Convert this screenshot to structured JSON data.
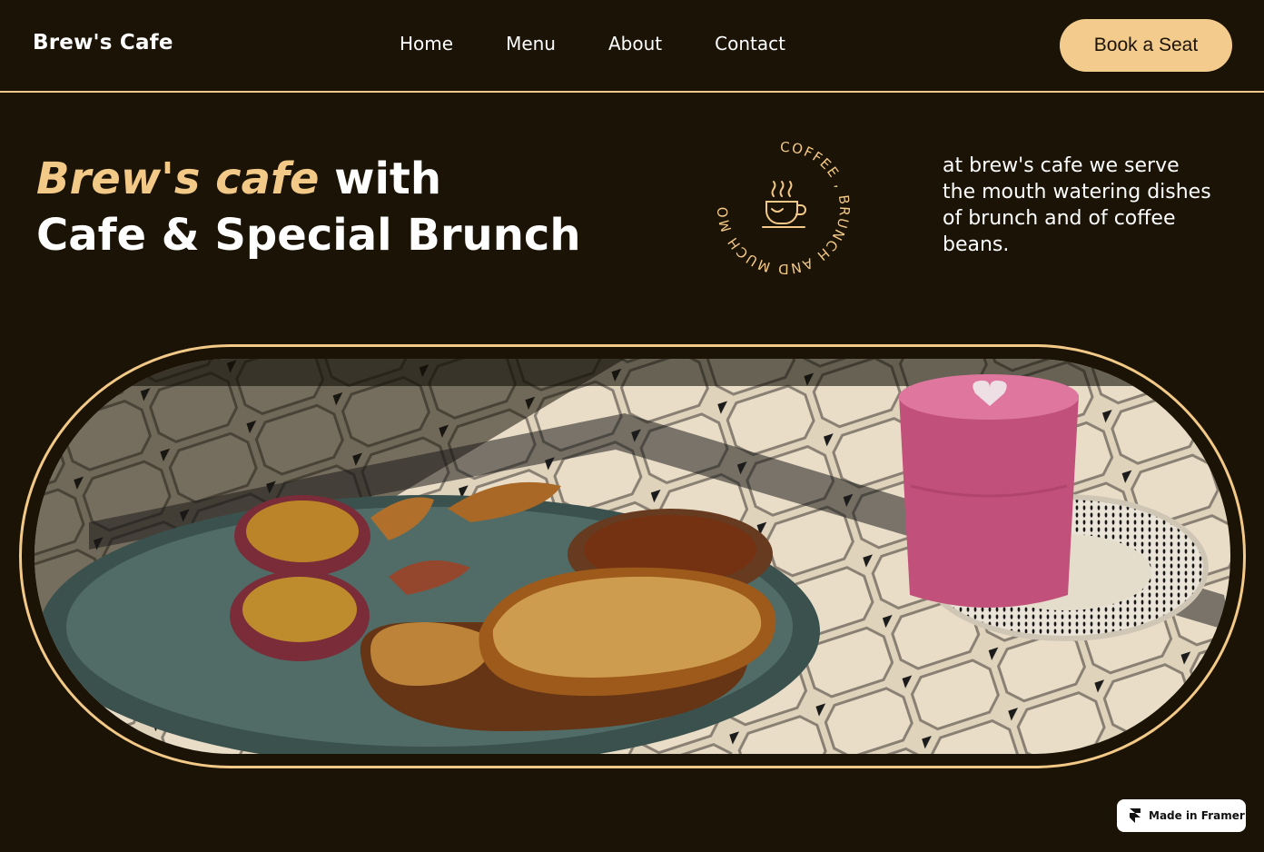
{
  "nav": {
    "brand": "Brew's Cafe",
    "links": [
      {
        "label": "Home"
      },
      {
        "label": "Menu"
      },
      {
        "label": "About"
      },
      {
        "label": "Contact"
      }
    ],
    "cta_label": "Book a Seat"
  },
  "hero": {
    "title_accent": "Brew's cafe",
    "title_rest": " with",
    "title_line2": "Cafe & Special Brunch",
    "badge_text": "COFFEE , BRUNCH AND MUCH MORE DISH",
    "badge_icon": "coffee-cup-icon",
    "description": "at brew's cafe we serve the mouth watering dishes of brunch and of coffee beans."
  },
  "hero_image": {
    "subject": "french-toast-brunch-with-pink-latte-photo"
  },
  "framer_badge": {
    "label": "Made in Framer",
    "icon": "framer-logo-icon"
  },
  "colors": {
    "background": "#1b1305",
    "accent": "#f3c987",
    "button": "#f3cb8c",
    "text": "#ffffff"
  }
}
